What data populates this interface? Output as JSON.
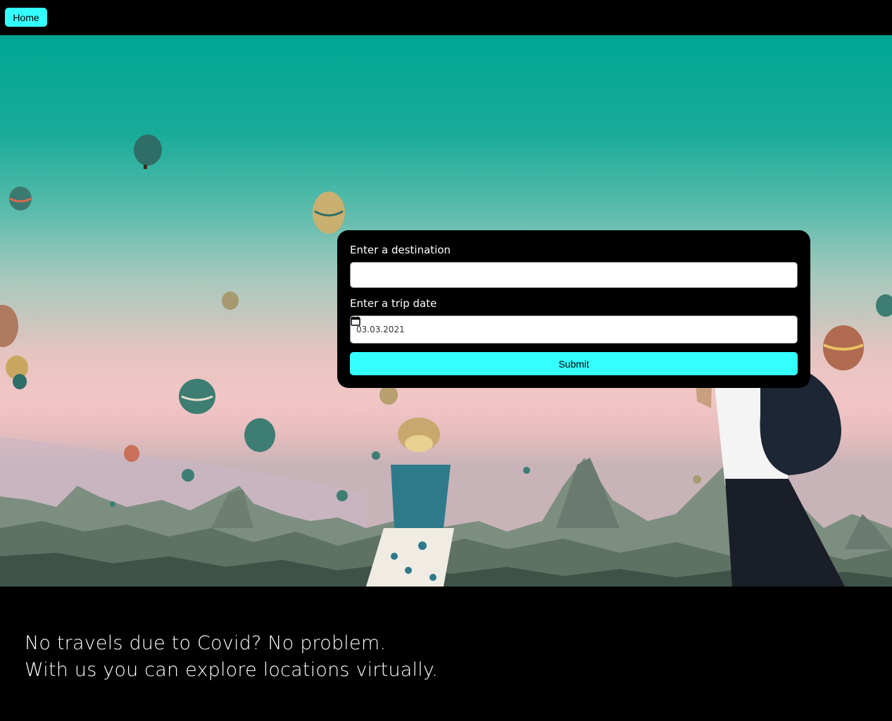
{
  "nav": {
    "home_label": "Home"
  },
  "form": {
    "destination_label": "Enter a destination",
    "destination_value": "",
    "date_label": "Enter a trip date",
    "date_value": "03.03.2021",
    "submit_label": "Submit"
  },
  "tagline": {
    "line1": "No travels due to Covid? No problem.",
    "line2": "With us you can explore locations virtually."
  },
  "colors": {
    "accent": "#33ffff",
    "background": "#000000"
  }
}
